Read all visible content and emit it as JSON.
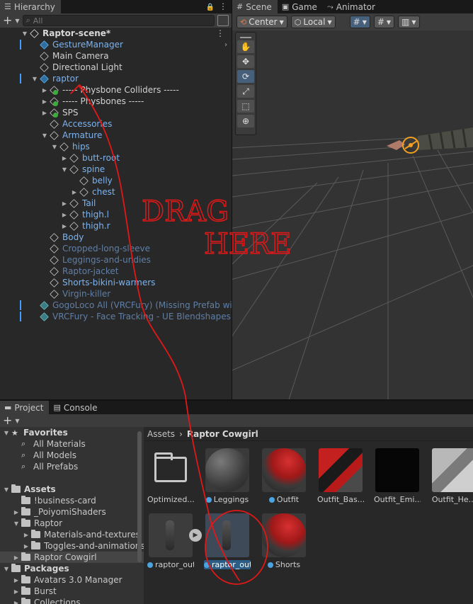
{
  "hierarchy": {
    "tab": "Hierarchy",
    "search_placeholder": "All",
    "rows": [
      {
        "label": "Raptor-scene*",
        "depth": 0,
        "arrow": "down",
        "icon": "unity-scene-icon",
        "style": "bold"
      },
      {
        "label": "GestureManager",
        "depth": 1,
        "arrow": "",
        "icon": "prefab-icon",
        "style": "blue",
        "bar": true
      },
      {
        "label": "Main Camera",
        "depth": 1,
        "arrow": "",
        "icon": "gameobject-icon",
        "style": "white"
      },
      {
        "label": "Directional Light",
        "depth": 1,
        "arrow": "",
        "icon": "gameobject-icon",
        "style": "white"
      },
      {
        "label": "raptor",
        "depth": 1,
        "arrow": "down",
        "icon": "prefab-icon",
        "style": "blue",
        "bar": true
      },
      {
        "label": "----- Physbone Colliders -----",
        "depth": 2,
        "arrow": "right",
        "icon": "gameobject-badge-icon",
        "style": "white"
      },
      {
        "label": "----- Physbones -----",
        "depth": 2,
        "arrow": "right",
        "icon": "gameobject-badge-icon",
        "style": "white"
      },
      {
        "label": "SPS",
        "depth": 2,
        "arrow": "right",
        "icon": "gameobject-badge-icon",
        "style": "white"
      },
      {
        "label": "Accessories",
        "depth": 2,
        "arrow": "",
        "icon": "gameobject-icon",
        "style": "blue"
      },
      {
        "label": "Armature",
        "depth": 2,
        "arrow": "down",
        "icon": "gameobject-icon",
        "style": "blue"
      },
      {
        "label": "hips",
        "depth": 3,
        "arrow": "down",
        "icon": "gameobject-icon",
        "style": "blue"
      },
      {
        "label": "butt-root",
        "depth": 4,
        "arrow": "right",
        "icon": "gameobject-icon",
        "style": "blue"
      },
      {
        "label": "spine",
        "depth": 4,
        "arrow": "down",
        "icon": "gameobject-icon",
        "style": "blue"
      },
      {
        "label": "belly",
        "depth": 5,
        "arrow": "",
        "icon": "gameobject-icon",
        "style": "blue"
      },
      {
        "label": "chest",
        "depth": 5,
        "arrow": "right",
        "icon": "gameobject-icon",
        "style": "blue"
      },
      {
        "label": "Tail",
        "depth": 4,
        "arrow": "right",
        "icon": "gameobject-icon",
        "style": "blue"
      },
      {
        "label": "thigh.l",
        "depth": 4,
        "arrow": "right",
        "icon": "gameobject-icon",
        "style": "blue"
      },
      {
        "label": "thigh.r",
        "depth": 4,
        "arrow": "right",
        "icon": "gameobject-icon",
        "style": "blue"
      },
      {
        "label": "Body",
        "depth": 2,
        "arrow": "",
        "icon": "gameobject-icon",
        "style": "blue"
      },
      {
        "label": "Cropped-long-sleeve",
        "depth": 2,
        "arrow": "",
        "icon": "gameobject-icon",
        "style": "dim"
      },
      {
        "label": "Leggings-and-undies",
        "depth": 2,
        "arrow": "",
        "icon": "gameobject-icon",
        "style": "dim"
      },
      {
        "label": "Raptor-jacket",
        "depth": 2,
        "arrow": "",
        "icon": "gameobject-icon",
        "style": "dim"
      },
      {
        "label": "Shorts-bikini-warmers",
        "depth": 2,
        "arrow": "",
        "icon": "gameobject-icon",
        "style": "blue"
      },
      {
        "label": "Virgin-killer",
        "depth": 2,
        "arrow": "",
        "icon": "gameobject-icon",
        "style": "dim"
      },
      {
        "label": "GogoLoco All (VRCFury) (Missing Prefab with guid...",
        "depth": 1,
        "arrow": "",
        "icon": "missing-prefab-icon",
        "style": "dim",
        "bar": true
      },
      {
        "label": "VRCFury - Face Tracking - UE Blendshapes",
        "depth": 1,
        "arrow": "",
        "icon": "missing-prefab-icon",
        "style": "dim",
        "bar": true
      }
    ]
  },
  "scene": {
    "tabs": [
      {
        "label": "Scene",
        "icon": "grid-icon",
        "active": true
      },
      {
        "label": "Game",
        "icon": "gamepad-icon",
        "active": false
      },
      {
        "label": "Animator",
        "icon": "animator-icon",
        "active": false
      }
    ],
    "pivot_label": "Center",
    "space_label": "Local"
  },
  "project": {
    "tabs": [
      {
        "label": "Project",
        "icon": "folder-icon",
        "active": true
      },
      {
        "label": "Console",
        "icon": "console-icon",
        "active": false
      }
    ],
    "tree": [
      {
        "label": "Favorites",
        "type": "head",
        "icon": "star-icon",
        "arrow": "down",
        "depth": 0
      },
      {
        "label": "All Materials",
        "type": "search",
        "depth": 1
      },
      {
        "label": "All Models",
        "type": "search",
        "depth": 1
      },
      {
        "label": "All Prefabs",
        "type": "search",
        "depth": 1
      },
      {
        "label": "",
        "type": "spacer",
        "depth": 0
      },
      {
        "label": "Assets",
        "type": "head",
        "icon": "folder-icon",
        "arrow": "down",
        "depth": 0
      },
      {
        "label": "!business-card",
        "type": "folder",
        "arrow": "",
        "depth": 1
      },
      {
        "label": "_PoiyomiShaders",
        "type": "folder",
        "arrow": "right",
        "depth": 1
      },
      {
        "label": "Raptor",
        "type": "folder",
        "arrow": "down",
        "depth": 1
      },
      {
        "label": "Materials-and-textures",
        "type": "folder",
        "arrow": "right",
        "depth": 2
      },
      {
        "label": "Toggles-and-animations",
        "type": "folder",
        "arrow": "right",
        "depth": 2
      },
      {
        "label": "Raptor Cowgirl",
        "type": "folder",
        "arrow": "right",
        "depth": 1,
        "selected": true
      },
      {
        "label": "Packages",
        "type": "head",
        "icon": "folder-icon",
        "arrow": "down",
        "depth": 0
      },
      {
        "label": "Avatars 3.0 Manager",
        "type": "folder",
        "arrow": "right",
        "depth": 1
      },
      {
        "label": "Burst",
        "type": "folder",
        "arrow": "right",
        "depth": 1
      },
      {
        "label": "Collections",
        "type": "folder",
        "arrow": "right",
        "depth": 1
      }
    ],
    "breadcrumb": {
      "root": "Assets",
      "current": "Raptor Cowgirl"
    },
    "assets": [
      {
        "name": "Optimized...",
        "kind": "folder",
        "dot": false
      },
      {
        "name": "Leggings",
        "kind": "sphere-dark",
        "dot": true
      },
      {
        "name": "Outfit",
        "kind": "sphere-red",
        "dot": true
      },
      {
        "name": "Outfit_Bas...",
        "kind": "texture-red",
        "dot": false
      },
      {
        "name": "Outfit_Emi...",
        "kind": "texture-black",
        "dot": false
      },
      {
        "name": "Outfit_He...",
        "kind": "texture-gray",
        "dot": false
      },
      {
        "name": "raptor_outf...",
        "kind": "model",
        "dot": true
      },
      {
        "name": "raptor_outf...",
        "kind": "prefab-selected",
        "dot": true,
        "selected": true
      },
      {
        "name": "Shorts",
        "kind": "sphere-red",
        "dot": true
      }
    ]
  },
  "annotation": {
    "line1": "DRAG",
    "line2": "HERE",
    "color": "#e01818"
  },
  "colors": {
    "panel_bg": "#282828",
    "toolbar_bg": "#3c3c3c",
    "selection": "#2c5d87",
    "blue_text": "#7cb4f0"
  }
}
